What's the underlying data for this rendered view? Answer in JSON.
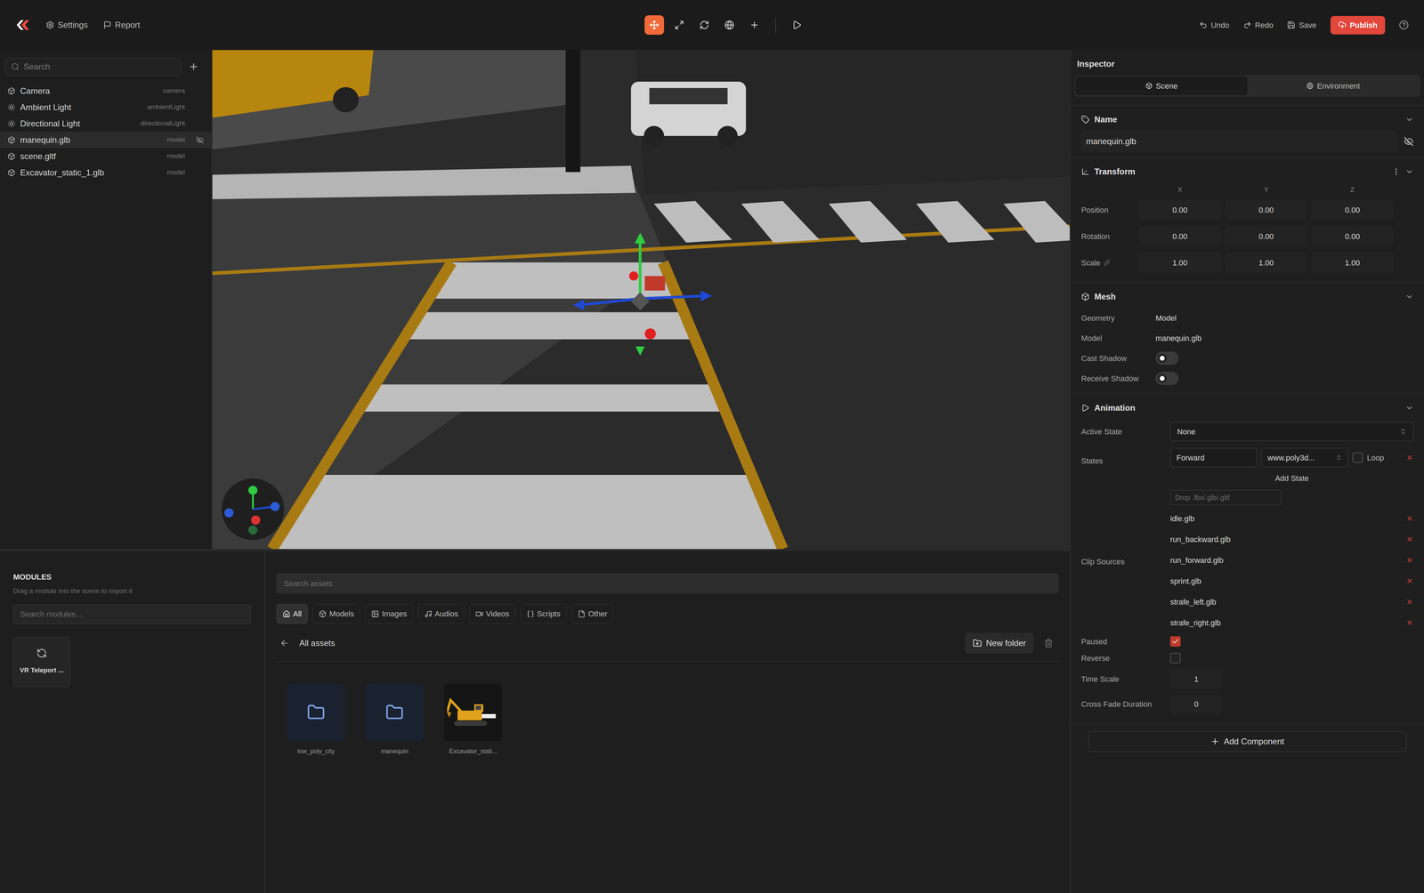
{
  "topbar": {
    "left": [
      {
        "label": "Settings",
        "kind": "settings"
      },
      {
        "label": "Report",
        "kind": "report"
      }
    ],
    "tools": [
      {
        "kind": "move",
        "selected": true
      },
      {
        "kind": "scale",
        "selected": false
      },
      {
        "kind": "rotate",
        "selected": false
      },
      {
        "kind": "world",
        "selected": false
      },
      {
        "kind": "add",
        "selected": false
      },
      {
        "kind": "play",
        "selected": false
      }
    ],
    "right": [
      {
        "label": "Undo",
        "kind": "undo"
      },
      {
        "label": "Redo",
        "kind": "redo"
      },
      {
        "label": "Save",
        "kind": "save"
      }
    ],
    "publish": "Publish"
  },
  "hierarchy": {
    "search_placeholder": "Search",
    "items": [
      {
        "name": "Camera",
        "type": "camera",
        "kind": "camera",
        "selected": false,
        "hidden": false
      },
      {
        "name": "Ambient Light",
        "type": "ambientLight",
        "kind": "light",
        "selected": false,
        "hidden": false
      },
      {
        "name": "Directional Light",
        "type": "directionalLight",
        "kind": "light",
        "selected": false,
        "hidden": false
      },
      {
        "name": "manequin.glb",
        "type": "model",
        "kind": "model",
        "selected": true,
        "hidden": true
      },
      {
        "name": "scene.gltf",
        "type": "model",
        "kind": "model",
        "selected": false,
        "hidden": false
      },
      {
        "name": "Excavator_static_1.glb",
        "type": "model",
        "kind": "model",
        "selected": false,
        "hidden": false
      }
    ]
  },
  "inspector": {
    "title": "Inspector",
    "tabs": [
      {
        "label": "Scene",
        "kind": "scene",
        "selected": true
      },
      {
        "label": "Environment",
        "kind": "environment",
        "selected": false
      }
    ],
    "name": {
      "title": "Name",
      "value": "manequin.glb",
      "hidden": true
    },
    "transform": {
      "title": "Transform",
      "axes": [
        "X",
        "Y",
        "Z"
      ],
      "rows": [
        {
          "label": "Position",
          "values": [
            "0.00",
            "0.00",
            "0.00"
          ],
          "linked": false
        },
        {
          "label": "Rotation",
          "values": [
            "0.00",
            "0.00",
            "0.00"
          ],
          "linked": false
        },
        {
          "label": "Scale",
          "values": [
            "1.00",
            "1.00",
            "1.00"
          ],
          "linked": true
        }
      ]
    },
    "mesh": {
      "title": "Mesh",
      "fields": [
        {
          "label": "Geometry",
          "value": "Model",
          "kind": "text"
        },
        {
          "label": "Model",
          "value": "manequin.glb",
          "kind": "text"
        },
        {
          "label": "Cast Shadow",
          "on": false,
          "kind": "switch"
        },
        {
          "label": "Receive Shadow",
          "on": false,
          "kind": "switch"
        }
      ]
    },
    "animation": {
      "title": "Animation",
      "active_state": {
        "label": "Active State",
        "value": "None"
      },
      "states": {
        "label": "States",
        "items": [
          {
            "name": "Forward",
            "source": "www.poly3d...",
            "loop_label": "Loop",
            "loop": false
          }
        ],
        "add": "Add State"
      },
      "clip_sources": {
        "label": "Clip Sources",
        "drop_placeholder": "Drop .fbx/.glb/.gltf",
        "items": [
          "idle.glb",
          "run_backward.glb",
          "run_forward.glb",
          "sprint.glb",
          "strafe_left.glb",
          "strafe_right.glb"
        ]
      },
      "paused": {
        "label": "Paused",
        "checked": true
      },
      "reverse": {
        "label": "Reverse",
        "checked": false
      },
      "time_scale": {
        "label": "Time Scale",
        "value": "1"
      },
      "cross_fade": {
        "label": "Cross Fade Duration",
        "value": "0"
      }
    },
    "add_component": "Add Component"
  },
  "modules": {
    "title": "MODULES",
    "hint": "Drag a module into the scene to import it",
    "search_placeholder": "Search modules...",
    "items": [
      {
        "label": "VR Teleport ..."
      }
    ]
  },
  "assets": {
    "search_placeholder": "Search assets",
    "filters": [
      {
        "label": "All",
        "kind": "all",
        "selected": true
      },
      {
        "label": "Models",
        "kind": "models",
        "selected": false
      },
      {
        "label": "Images",
        "kind": "images",
        "selected": false
      },
      {
        "label": "Audios",
        "kind": "audios",
        "selected": false
      },
      {
        "label": "Videos",
        "kind": "videos",
        "selected": false
      },
      {
        "label": "Scripts",
        "kind": "scripts",
        "selected": false
      },
      {
        "label": "Other",
        "kind": "other",
        "selected": false
      }
    ],
    "breadcrumb": "All assets",
    "new_folder": "New folder",
    "items": [
      {
        "label": "low_poly_city",
        "kind": "folder"
      },
      {
        "label": "manequin",
        "kind": "folder"
      },
      {
        "label": "Excavator_stati...",
        "kind": "model"
      }
    ]
  }
}
